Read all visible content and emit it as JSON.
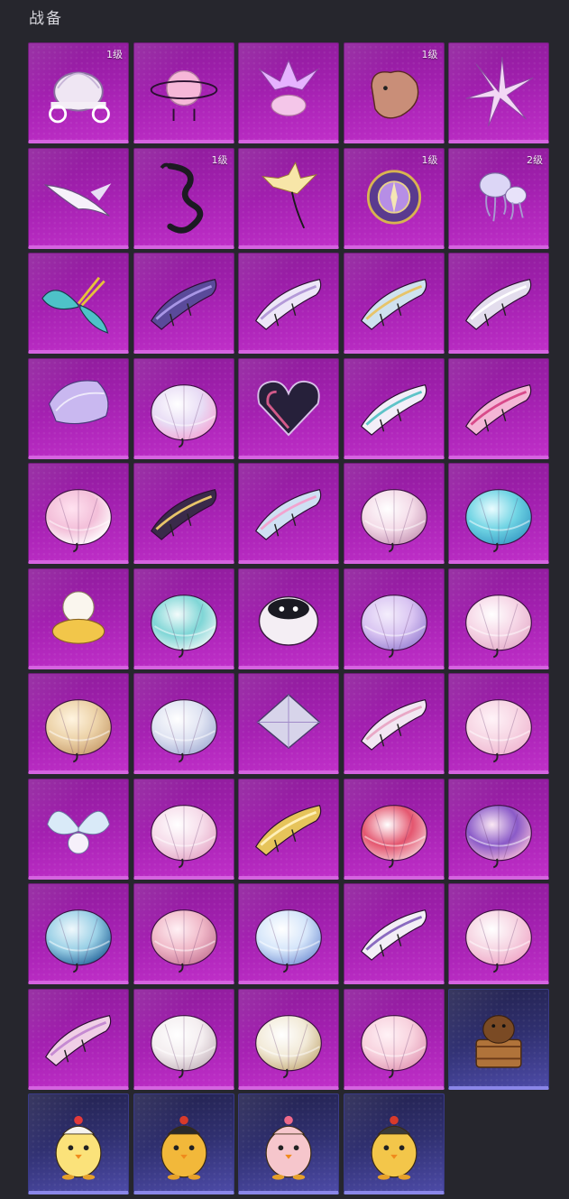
{
  "section": {
    "title": "战备"
  },
  "items": [
    {
      "name": "pumpkin-carriage",
      "badge": "1级",
      "tier": "purple"
    },
    {
      "name": "planet-orb",
      "badge": "",
      "tier": "purple"
    },
    {
      "name": "crystal-bouquet",
      "badge": "",
      "tier": "purple"
    },
    {
      "name": "heart-pet",
      "badge": "1级",
      "tier": "purple"
    },
    {
      "name": "crystal-burst",
      "badge": "",
      "tier": "purple"
    },
    {
      "name": "white-wings",
      "badge": "",
      "tier": "purple"
    },
    {
      "name": "black-dragon",
      "badge": "1级",
      "tier": "purple"
    },
    {
      "name": "golden-flower",
      "badge": "",
      "tier": "purple"
    },
    {
      "name": "violet-compass",
      "badge": "1级",
      "tier": "purple"
    },
    {
      "name": "jellyfish-cluster",
      "badge": "2级",
      "tier": "purple"
    },
    {
      "name": "butterfly-glider",
      "badge": "",
      "tier": "purple"
    },
    {
      "name": "purple-glider",
      "badge": "",
      "tier": "purple"
    },
    {
      "name": "lilac-glider",
      "badge": "",
      "tier": "purple"
    },
    {
      "name": "pastel-glider",
      "badge": "",
      "tier": "purple"
    },
    {
      "name": "silver-glider",
      "badge": "",
      "tier": "purple"
    },
    {
      "name": "feather-parachute",
      "badge": "",
      "tier": "purple"
    },
    {
      "name": "cloud-parachute",
      "badge": "",
      "tier": "purple"
    },
    {
      "name": "heart-parachute",
      "badge": "",
      "tier": "purple"
    },
    {
      "name": "teal-glider",
      "badge": "",
      "tier": "purple"
    },
    {
      "name": "flower-glider",
      "badge": "",
      "tier": "purple"
    },
    {
      "name": "pink-parachute",
      "badge": "",
      "tier": "purple"
    },
    {
      "name": "gold-swirl-glider",
      "badge": "",
      "tier": "purple"
    },
    {
      "name": "blossom-glider",
      "badge": "",
      "tier": "purple"
    },
    {
      "name": "rose-parachute",
      "badge": "",
      "tier": "purple"
    },
    {
      "name": "aqua-parachute",
      "badge": "",
      "tier": "purple"
    },
    {
      "name": "sheep-parachute",
      "badge": "",
      "tier": "purple"
    },
    {
      "name": "mint-parachute",
      "badge": "",
      "tier": "purple"
    },
    {
      "name": "cat-parachute",
      "badge": "",
      "tier": "purple"
    },
    {
      "name": "lavender-parachute",
      "badge": "",
      "tier": "purple"
    },
    {
      "name": "lace-parachute",
      "badge": "",
      "tier": "purple"
    },
    {
      "name": "cream-parachute",
      "badge": "",
      "tier": "purple"
    },
    {
      "name": "porcelain-parachute",
      "badge": "",
      "tier": "purple"
    },
    {
      "name": "diamond-parachute",
      "badge": "",
      "tier": "purple"
    },
    {
      "name": "stripe-glider",
      "badge": "",
      "tier": "purple"
    },
    {
      "name": "ribbon-parachute",
      "badge": "",
      "tier": "purple"
    },
    {
      "name": "fairy-parachute",
      "badge": "",
      "tier": "purple"
    },
    {
      "name": "bow-parachute",
      "badge": "",
      "tier": "purple"
    },
    {
      "name": "gold-glider",
      "badge": "",
      "tier": "purple"
    },
    {
      "name": "fan-parachute",
      "badge": "",
      "tier": "purple"
    },
    {
      "name": "candy-parachute",
      "badge": "",
      "tier": "purple"
    },
    {
      "name": "ocean-parachute",
      "badge": "",
      "tier": "purple"
    },
    {
      "name": "donut-parachute",
      "badge": "",
      "tier": "purple"
    },
    {
      "name": "jelly-parachute",
      "badge": "",
      "tier": "purple"
    },
    {
      "name": "silk-glider",
      "badge": "",
      "tier": "purple"
    },
    {
      "name": "crown-parachute",
      "badge": "",
      "tier": "purple"
    },
    {
      "name": "pink-glider",
      "badge": "",
      "tier": "purple"
    },
    {
      "name": "bunny-parachute",
      "badge": "",
      "tier": "purple"
    },
    {
      "name": "floral-parachute",
      "badge": "",
      "tier": "purple"
    },
    {
      "name": "plaid-parachute",
      "badge": "",
      "tier": "purple"
    },
    {
      "name": "capybara-bath",
      "badge": "",
      "tier": "blue"
    },
    {
      "name": "chick-egg",
      "badge": "",
      "tier": "blue"
    },
    {
      "name": "rooster-shades",
      "badge": "",
      "tier": "blue"
    },
    {
      "name": "pink-chick",
      "badge": "",
      "tier": "blue"
    },
    {
      "name": "helmet-chick",
      "badge": "",
      "tier": "blue"
    }
  ],
  "colors": {
    "purple_tile": "#a11fae",
    "blue_tile": "#303070",
    "background": "#26262d"
  }
}
